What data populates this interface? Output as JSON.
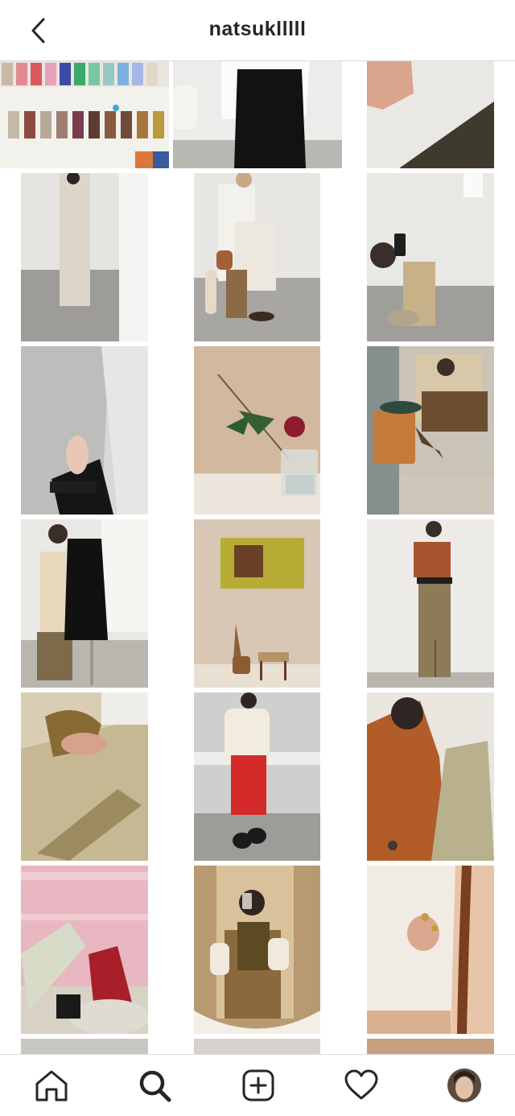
{
  "header": {
    "username": "natsuklllll",
    "back_icon": "chevron-left-icon"
  },
  "grid": {
    "columns": 3,
    "posts": [
      {
        "id": "p1",
        "subject": "color-swatches"
      },
      {
        "id": "p2",
        "subject": "white-shirt-black-dress"
      },
      {
        "id": "p3",
        "subject": "hand-on-white-fabric"
      },
      {
        "id": "p4",
        "subject": "linen-jumpsuit"
      },
      {
        "id": "p5",
        "subject": "white-outfit-stool"
      },
      {
        "id": "p6",
        "subject": "mirror-selfie-knit-vest"
      },
      {
        "id": "p7",
        "subject": "hand-black-sleeve-curtain"
      },
      {
        "id": "p8",
        "subject": "dahlia-pine-vase"
      },
      {
        "id": "p9",
        "subject": "seated-trench-coat"
      },
      {
        "id": "p10",
        "subject": "vest-skirt-black-dress"
      },
      {
        "id": "p11",
        "subject": "painting-stool"
      },
      {
        "id": "p12",
        "subject": "rust-knit-long-skirt"
      },
      {
        "id": "p13",
        "subject": "quilted-jacket-hand"
      },
      {
        "id": "p14",
        "subject": "turtleneck-red-pants"
      },
      {
        "id": "p15",
        "subject": "rust-turtleneck-quilted-vest"
      },
      {
        "id": "p16",
        "subject": "pink-shelf-knit-socks"
      },
      {
        "id": "p17",
        "subject": "mirror-selfie-brown-vest"
      },
      {
        "id": "p18",
        "subject": "quilted-sleeve-rings"
      }
    ]
  },
  "tabbar": {
    "items": [
      {
        "name": "home",
        "icon": "home-icon"
      },
      {
        "name": "search",
        "icon": "search-icon",
        "active": true
      },
      {
        "name": "create",
        "icon": "plus-square-icon"
      },
      {
        "name": "activity",
        "icon": "heart-icon"
      },
      {
        "name": "profile",
        "icon": "avatar"
      }
    ]
  }
}
